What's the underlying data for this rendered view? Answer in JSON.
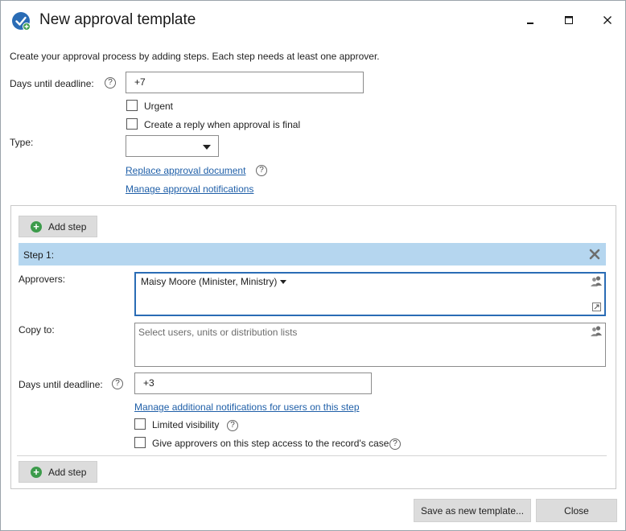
{
  "window": {
    "title": "New approval template"
  },
  "intro_text": "Create your approval process by adding steps. Each step needs at least one approver.",
  "template": {
    "days_until_deadline_label": "Days until deadline:",
    "days_until_deadline_value": "+7",
    "urgent_label": "Urgent",
    "urgent_checked": false,
    "create_reply_label": "Create a reply when approval is final",
    "create_reply_checked": false,
    "type_label": "Type:",
    "type_value": "",
    "replace_document_link": "Replace approval document",
    "manage_notifications_link": "Manage approval notifications",
    "help_glyph": "?"
  },
  "add_step_label": "Add step",
  "steps": [
    {
      "title": "Step 1:",
      "approvers_label": "Approvers:",
      "approvers": [
        "Maisy Moore (Minister, Ministry)"
      ],
      "copy_to_label": "Copy to:",
      "copy_to_placeholder": "Select users, units or distribution lists",
      "days_until_deadline_label": "Days until deadline:",
      "days_until_deadline_value": "+3",
      "manage_additional_notifications_link": "Manage additional notifications for users on this step",
      "limited_visibility_label": "Limited visibility",
      "limited_visibility_checked": false,
      "give_access_label": "Give approvers on this step access to the record's case",
      "give_access_checked": false
    }
  ],
  "footer": {
    "save_label": "Save as new template...",
    "close_label": "Close"
  },
  "colors": {
    "step_header_bg": "#b5d6ef",
    "link": "#1f5fa8",
    "app_icon": "#2a6cb5",
    "approvers_border": "#2a6cb5"
  },
  "icons": {
    "app": "check-circle-icon",
    "add_step": "plus-circle-icon",
    "remove_step": "close-x-icon",
    "select_people": "people-icon",
    "expand": "expand-icon",
    "help": "help-icon"
  }
}
